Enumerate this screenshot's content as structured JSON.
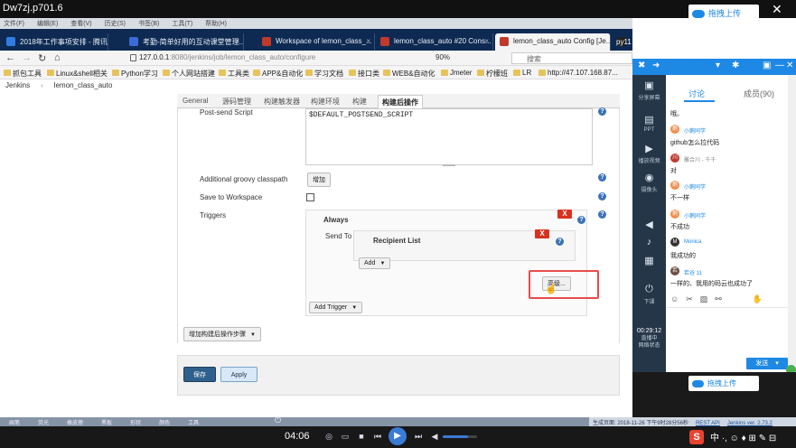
{
  "player": {
    "title": "Dw7zj.p701.6",
    "upload_label": "拖拽上传",
    "menu": [
      "文件(F)",
      "编辑(E)",
      "查看(V)",
      "历史(S)",
      "书签(B)",
      "工具(T)",
      "帮助(H)"
    ],
    "time": "04:06"
  },
  "browser": {
    "tabs": [
      {
        "label": "2018年工作事项安排 - 腾讯文...",
        "color": "#2f7de1"
      },
      {
        "label": "考勤-简单好用的互动课堂管理...",
        "color": "#3c6bd8"
      },
      {
        "label": "Workspace of lemon_class_...",
        "color": "#c0392b"
      },
      {
        "label": "lemon_class_auto #20 Cons...",
        "color": "#c0392b"
      },
      {
        "label": "lemon_class_auto Config [Je...",
        "color": "#c0392b"
      },
      {
        "label": "py11 auto_test_api",
        "color": "#222222"
      }
    ],
    "url_host": "127.0.0.1",
    "url_path": ":8080/jenkins/job/lemon_class_auto/configure",
    "zoom": "90%",
    "search_placeholder": "搜索",
    "bookmarks": [
      "抓包工具",
      "Linux&shell相关",
      "Python学习",
      "个人网站搭建",
      "工具类",
      "APP&自动化",
      "学习文档",
      "接口类",
      "WEB&自动化",
      "Jmeter",
      "柠檬班",
      "LR",
      "http://47.107.168.87..."
    ]
  },
  "jenkins": {
    "breadcrumb": [
      "Jenkins",
      "lemon_class_auto"
    ],
    "tabs": [
      "General",
      "源码管理",
      "构建触发器",
      "构建环境",
      "构建",
      "构建后操作"
    ],
    "post_send_label": "Post-send Script",
    "post_send_value": "$DEFAULT_POSTSEND_SCRIPT",
    "groovy_label": "Additional groovy classpath",
    "groovy_button": "增加",
    "save_ws_label": "Save to Workspace",
    "triggers_label": "Triggers",
    "always_label": "Always",
    "send_to_label": "Send To",
    "recipient_label": "Recipient List",
    "add_button": "Add",
    "advanced_button": "高级...",
    "add_trigger_button": "Add Trigger",
    "add_post_step_button": "增加构建后操作步骤",
    "save_button": "保存",
    "apply_button": "Apply",
    "close_x": "X",
    "help_q": "?",
    "footer_page": "生成页面: 2018-11-26 下午9时28分56秒",
    "footer_rest": "REST API",
    "footer_version": "Jenkins ver. 2.73.2"
  },
  "taskbar": [
    "画笔",
    "荧光",
    "橡皮擦",
    "黑板",
    "形状",
    "颜色",
    "工具"
  ],
  "live": {
    "tools": [
      {
        "icon": "share-screen",
        "glyph": "▣",
        "label": "分享屏幕"
      },
      {
        "icon": "ppt",
        "glyph": "▤",
        "label": "PPT"
      },
      {
        "icon": "play-video",
        "glyph": "▶",
        "label": "播放视频"
      },
      {
        "icon": "camera",
        "glyph": "◉",
        "label": "摄像头"
      },
      {
        "icon": "volume",
        "glyph": "◀",
        "label": ""
      },
      {
        "icon": "music",
        "glyph": "♪",
        "label": ""
      },
      {
        "icon": "more",
        "glyph": "▦",
        "label": ""
      },
      {
        "icon": "class-off",
        "glyph": "⏻",
        "label": "下课"
      }
    ],
    "timer": "00:29:12",
    "timer_label1": "直播中",
    "timer_label2": "网络状态",
    "chat_tabs": [
      "讨论",
      "成员(90)"
    ],
    "messages": [
      {
        "name": "",
        "text": "哦。"
      },
      {
        "name": "小鹅同学",
        "text": "github怎么拉代码"
      },
      {
        "name": "雕合川 - 千千",
        "text": "对"
      },
      {
        "name": "小鹅同学",
        "text": "不一样"
      },
      {
        "name": "小鹅同学",
        "text": "不成功"
      },
      {
        "name": "Monica",
        "text": "我成功的"
      },
      {
        "name": "若谷 11",
        "text": "一样的、我用的码云也成功了"
      }
    ],
    "send_label": "发送"
  }
}
